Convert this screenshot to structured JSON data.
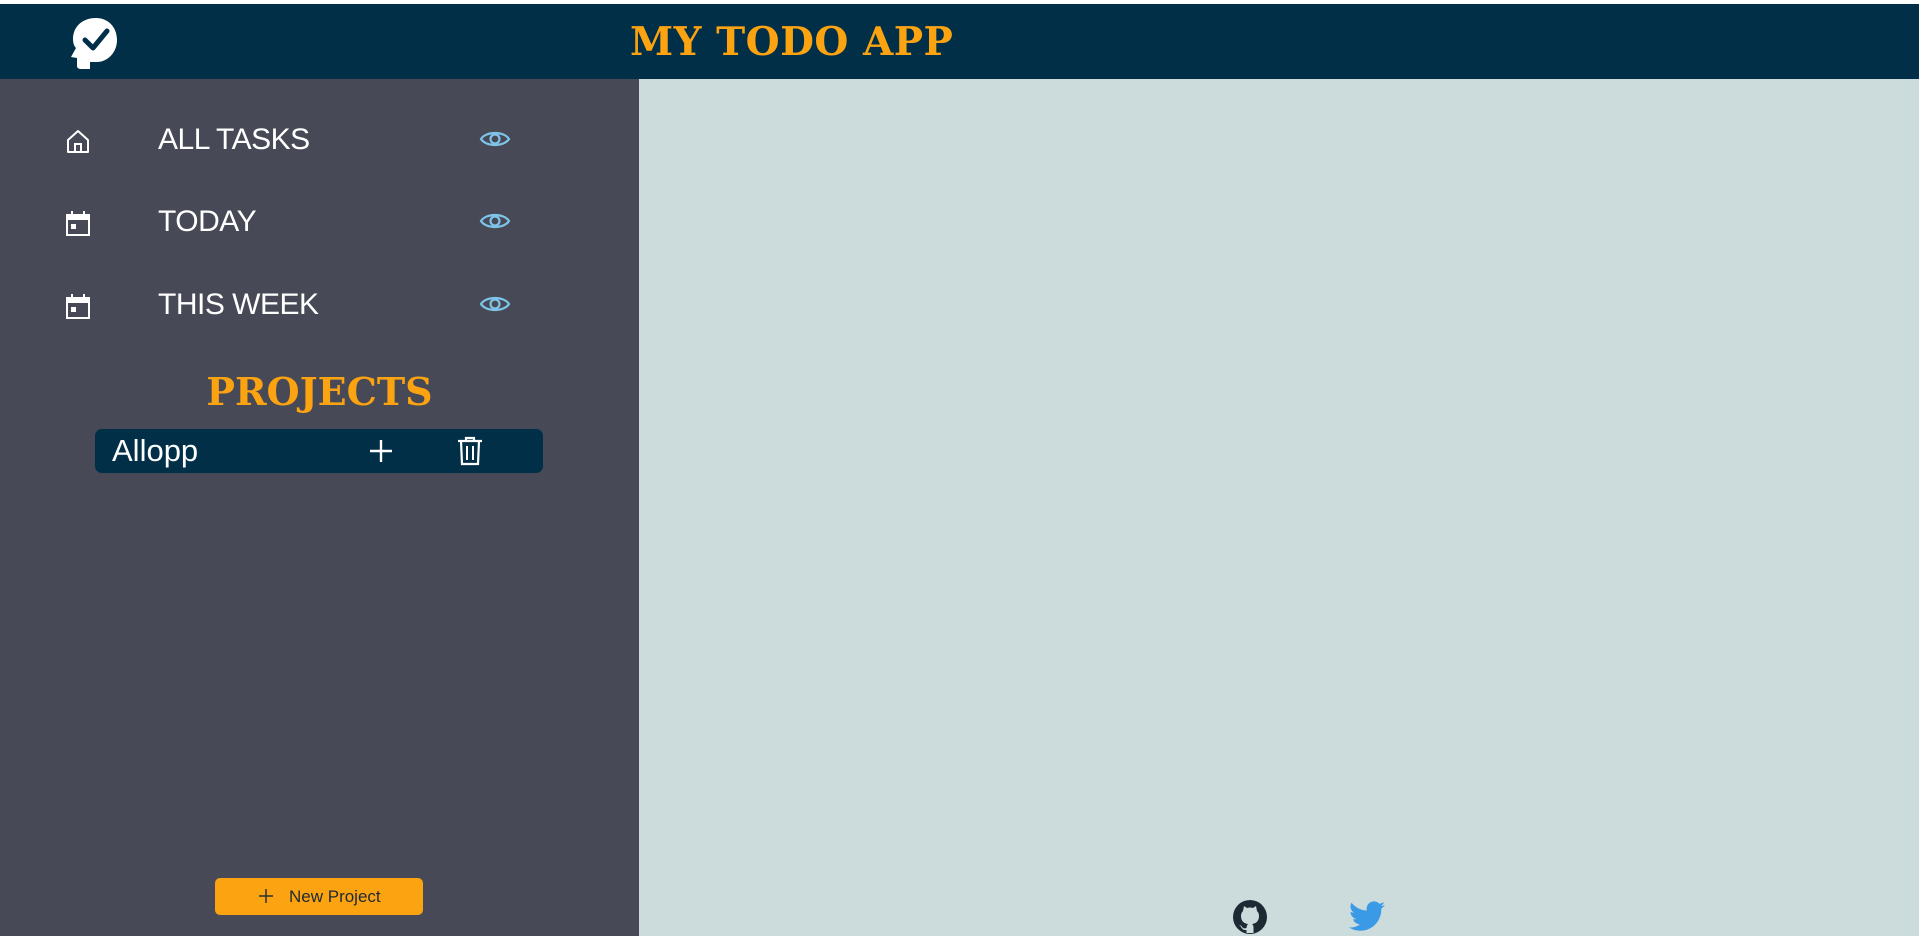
{
  "app": {
    "title": "MY TODO APP"
  },
  "colors": {
    "header_bg": "#002f47",
    "accent": "#fca311",
    "sidebar_bg": "#474a56",
    "main_bg": "#ccdcdd",
    "eye_icon": "#7fc3e8",
    "twitter": "#3b9ae6",
    "github": "#1d2a33"
  },
  "sidebar": {
    "nav": [
      {
        "label": "ALL TASKS",
        "icon": "home-icon"
      },
      {
        "label": "TODAY",
        "icon": "calendar-icon"
      },
      {
        "label": "THIS WEEK",
        "icon": "calendar-icon"
      }
    ],
    "visibility_icon": "eye-icon",
    "projects_heading": "PROJECTS",
    "projects": [
      {
        "name": "Allopp",
        "actions": [
          "plus-icon",
          "trash-icon"
        ]
      }
    ],
    "new_project_label": "New Project"
  },
  "footer": {
    "links": [
      "github-icon",
      "twitter-icon"
    ]
  }
}
